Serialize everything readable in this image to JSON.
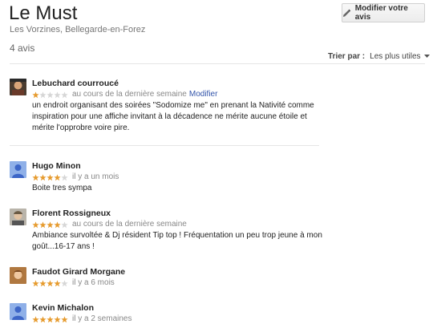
{
  "place": {
    "title": "Le Must",
    "address": "Les Vorzines, Bellegarde-en-Forez"
  },
  "actions": {
    "edit_review_label": "Modifier votre avis"
  },
  "summary": {
    "count_label": "4 avis"
  },
  "sort": {
    "label": "Trier par :",
    "value": "Les plus utiles"
  },
  "colors": {
    "star_filled": "#e69b2e",
    "star_empty": "#d6d6d6",
    "link": "#3355aa"
  },
  "reviews": [
    {
      "author": "Lebuchard courroucé",
      "rating": 1,
      "date": "au cours de la dernière semaine",
      "edit_link": "Modifier",
      "text": "un endroit organisant des soirées \"Sodomize me\" en prenant la Nativité comme inspiration pour une affiche invitant à la décadence ne mérite aucune étoile et mérite l'opprobre voire pire.",
      "avatar": "photo"
    },
    {
      "author": "Hugo Minon",
      "rating": 4,
      "date": "il y a un mois",
      "text": "Boite tres sympa",
      "avatar": "default-person-icon"
    },
    {
      "author": "Florent Rossigneux",
      "rating": 4,
      "date": "au cours de la dernière semaine",
      "text": "Ambiance survoltée & Dj résident Tip top ! Fréquentation un peu trop jeune à mon goût...16-17 ans !",
      "avatar": "photo"
    },
    {
      "author": "Faudot Girard Morgane",
      "rating": 4,
      "date": "il y a 6 mois",
      "text": "",
      "avatar": "photo"
    },
    {
      "author": "Kevin Michalon",
      "rating": 5,
      "date": "il y a 2 semaines",
      "text": "",
      "avatar": "default-person-icon"
    }
  ]
}
